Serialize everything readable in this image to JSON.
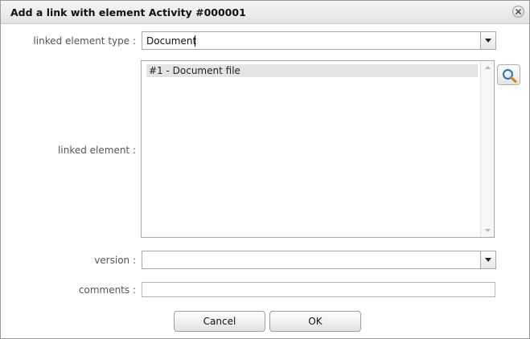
{
  "dialog": {
    "title": "Add a link with element Activity #000001"
  },
  "form": {
    "linked_type_label": "linked element type :",
    "linked_type_value": "Document",
    "linked_element_label": "linked element :",
    "linked_elements": [
      "#1 - Document file"
    ],
    "version_label": "version :",
    "version_value": "",
    "comments_label": "comments :",
    "comments_value": ""
  },
  "buttons": {
    "cancel_label": "Cancel",
    "ok_label": "OK"
  },
  "icons": {
    "close": "close-icon",
    "dropdown": "chevron-down-icon",
    "search": "search-icon"
  }
}
